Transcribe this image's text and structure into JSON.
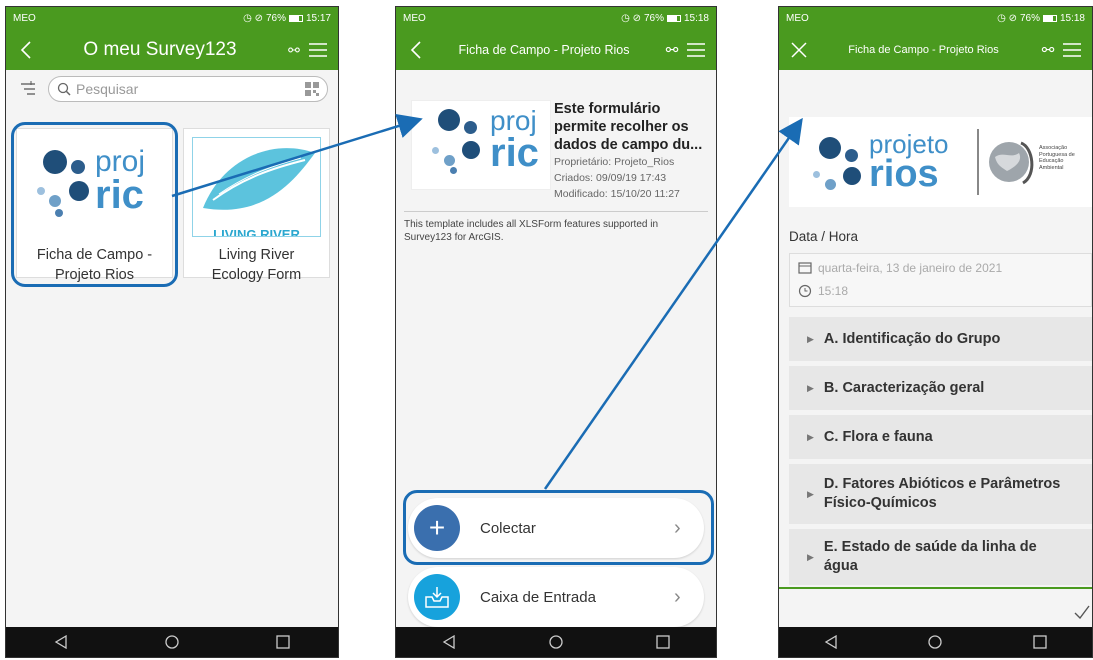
{
  "phone1": {
    "status": {
      "carrier": "MEO",
      "battery": "76%",
      "time": "15:17"
    },
    "title": "O meu Survey123",
    "search_placeholder": "Pesquisar",
    "cards": [
      {
        "label_line1": "Ficha de Campo -",
        "label_line2": "Projeto Rios",
        "logo_text": "proj",
        "logo_text2": "ric"
      },
      {
        "label_line1": "Living River",
        "label_line2": "Ecology Form",
        "logo_text": "LIVING RIVER"
      }
    ]
  },
  "phone2": {
    "status": {
      "carrier": "MEO",
      "battery": "76%",
      "time": "15:18"
    },
    "title": "Ficha de Campo - Projeto Rios",
    "form_title_lines": [
      "Este formulário",
      "permite recolher os",
      "dados de campo du..."
    ],
    "owner": "Proprietário: Projeto_Rios",
    "created": "Criados: 09/09/19 17:43",
    "modified": "Modificado: 15/10/20 11:27",
    "description": "This template includes all XLSForm features supported in Survey123 for ArcGIS.",
    "logo_text": "proj",
    "logo_text2": "ric",
    "collect_label": "Colectar",
    "inbox_label": "Caixa de Entrada"
  },
  "phone3": {
    "status": {
      "carrier": "MEO",
      "battery": "76%",
      "time": "15:18"
    },
    "title": "Ficha de Campo - Projeto Rios",
    "logo_text": "projeto",
    "logo_text2": "rios",
    "org_lines": [
      "Associação",
      "Portuguesa de",
      "Educação",
      "Ambiental"
    ],
    "datetime_label": "Data / Hora",
    "date_value": "quarta-feira, 13 de janeiro de 2021",
    "time_value": "15:18",
    "sections": [
      {
        "line1": "A. Identificação do Grupo"
      },
      {
        "line1": "B. Caracterização geral"
      },
      {
        "line1": "C. Flora e fauna"
      },
      {
        "line1": "D. Fatores Abióticos e Parâmetros",
        "line2": "Físico-Químicos"
      },
      {
        "line1": "E. Estado de saúde da linha de",
        "line2": "água"
      }
    ]
  },
  "colors": {
    "appbar": "#4a9a1f",
    "highlight": "#1a6cb4",
    "collect": "#3a6fae",
    "inbox": "#17a2dc"
  }
}
